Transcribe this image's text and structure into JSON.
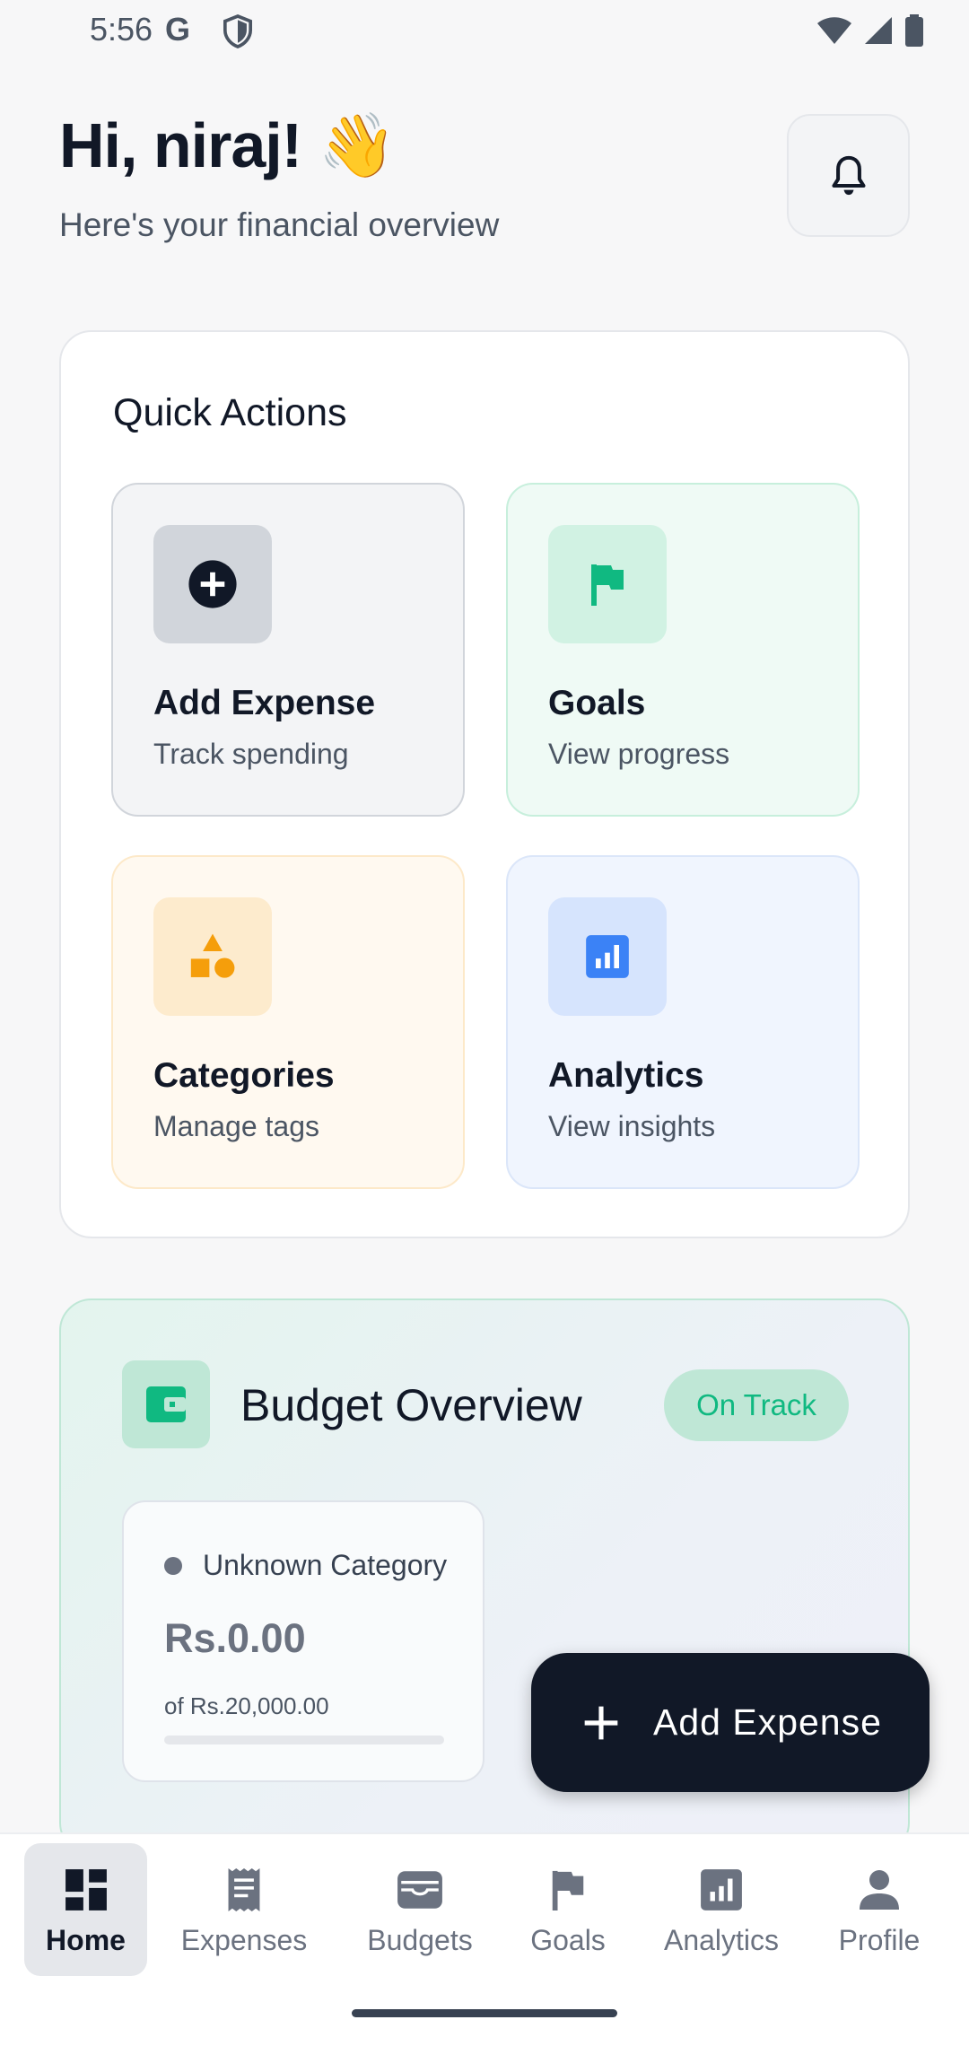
{
  "status_bar": {
    "time": "5:56",
    "google_glyph": "G",
    "shield_icon": "shield-icon",
    "wifi_icon": "wifi-icon",
    "signal_icon": "signal-icon",
    "battery_icon": "battery-icon"
  },
  "header": {
    "greeting": "Hi, niraj! 👋",
    "subtitle": "Here's your financial overview",
    "notification_icon": "bell-icon"
  },
  "quick_actions": {
    "title": "Quick Actions",
    "items": [
      {
        "title": "Add Expense",
        "subtitle": "Track spending",
        "icon": "plus-circle-icon",
        "color": "#111827"
      },
      {
        "title": "Goals",
        "subtitle": "View progress",
        "icon": "flag-icon",
        "color": "#10b981"
      },
      {
        "title": "Categories",
        "subtitle": "Manage tags",
        "icon": "shapes-icon",
        "color": "#f59e0b"
      },
      {
        "title": "Analytics",
        "subtitle": "View insights",
        "icon": "bar-chart-icon",
        "color": "#3b82f6"
      }
    ]
  },
  "budget_overview": {
    "title": "Budget Overview",
    "status": "On Track",
    "icon": "wallet-icon",
    "categories": [
      {
        "name": "Unknown Category",
        "spent": "Rs.0.00",
        "limit": "of Rs.20,000.00",
        "progress": 0
      }
    ]
  },
  "fab": {
    "label": "Add Expense",
    "icon": "plus-icon"
  },
  "bottom_nav": {
    "items": [
      {
        "label": "Home",
        "icon": "dashboard-icon",
        "active": true
      },
      {
        "label": "Expenses",
        "icon": "receipt-icon"
      },
      {
        "label": "Budgets",
        "icon": "wallet-icon"
      },
      {
        "label": "Goals",
        "icon": "flag-icon"
      },
      {
        "label": "Analytics",
        "icon": "bar-chart-icon"
      },
      {
        "label": "Profile",
        "icon": "person-icon"
      }
    ]
  },
  "colors": {
    "accent_green": "#10b981",
    "dark": "#111827",
    "orange": "#f59e0b",
    "blue": "#3b82f6"
  }
}
